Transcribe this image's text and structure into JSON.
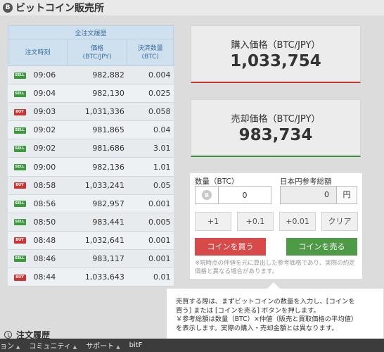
{
  "page_title": "ビットコイン販売所",
  "page_title_icon": "bitcoin-icon",
  "orders": {
    "header_title": "全注文履歴",
    "columns": [
      "注文時刻",
      "価格\n(BTC/JPY)",
      "決済数量\n(BTC)"
    ],
    "rows": [
      {
        "side": "SELL",
        "time": "09:06",
        "price": "982,882",
        "amount": "0.004"
      },
      {
        "side": "SELL",
        "time": "09:04",
        "price": "982,130",
        "amount": "0.025"
      },
      {
        "side": "BUY",
        "time": "09:03",
        "price": "1,031,336",
        "amount": "0.058"
      },
      {
        "side": "SELL",
        "time": "09:02",
        "price": "981,865",
        "amount": "0.04"
      },
      {
        "side": "SELL",
        "time": "09:02",
        "price": "981,686",
        "amount": "3.01"
      },
      {
        "side": "SELL",
        "time": "09:00",
        "price": "982,136",
        "amount": "1.01"
      },
      {
        "side": "BUY",
        "time": "08:58",
        "price": "1,033,241",
        "amount": "0.05"
      },
      {
        "side": "SELL",
        "time": "08:56",
        "price": "982,957",
        "amount": "0.001"
      },
      {
        "side": "SELL",
        "time": "08:50",
        "price": "983,441",
        "amount": "0.005"
      },
      {
        "side": "BUY",
        "time": "08:48",
        "price": "1,032,641",
        "amount": "0.001"
      },
      {
        "side": "SELL",
        "time": "08:46",
        "price": "983,117",
        "amount": "0.001"
      },
      {
        "side": "BUY",
        "time": "08:44",
        "price": "1,033,643",
        "amount": "0.01"
      }
    ]
  },
  "buy_price": {
    "label": "購入価格（BTC/JPY）",
    "value": "1,033,754",
    "accent": "#cc3333"
  },
  "sell_price": {
    "label": "売却価格（BTC/JPY）",
    "value": "983,734",
    "accent": "#3a8c3a"
  },
  "trade_form": {
    "qty_label": "数量（BTC）",
    "qty_icon": "bitcoin-icon",
    "qty_value": "0",
    "yen_label": "日本円参考総額",
    "yen_value": "0",
    "yen_unit": "円",
    "increments": [
      "+1",
      "+0.1",
      "+0.01"
    ],
    "clear_label": "クリア",
    "buy_label": "コインを買う",
    "sell_label": "コインを売る",
    "note": "※現時点の仲値を元に算出した参考価格であり、実際の約定価格と異なる場合があります。"
  },
  "tooltip": {
    "lines": [
      "売買する際は、まずビットコインの数量を入力し、[コインを",
      "買う] または [コインを売る] ボタンを押します。",
      "￥参考総額は数量（BTC）×仲値（販売と買取価格の平均値）",
      "を表示します。実際の購入・売却金額とは異なります。"
    ]
  },
  "history_title": "注文履歴",
  "navbar": [
    "ョン",
    "コミュニティ",
    "サポート",
    "bitF"
  ]
}
